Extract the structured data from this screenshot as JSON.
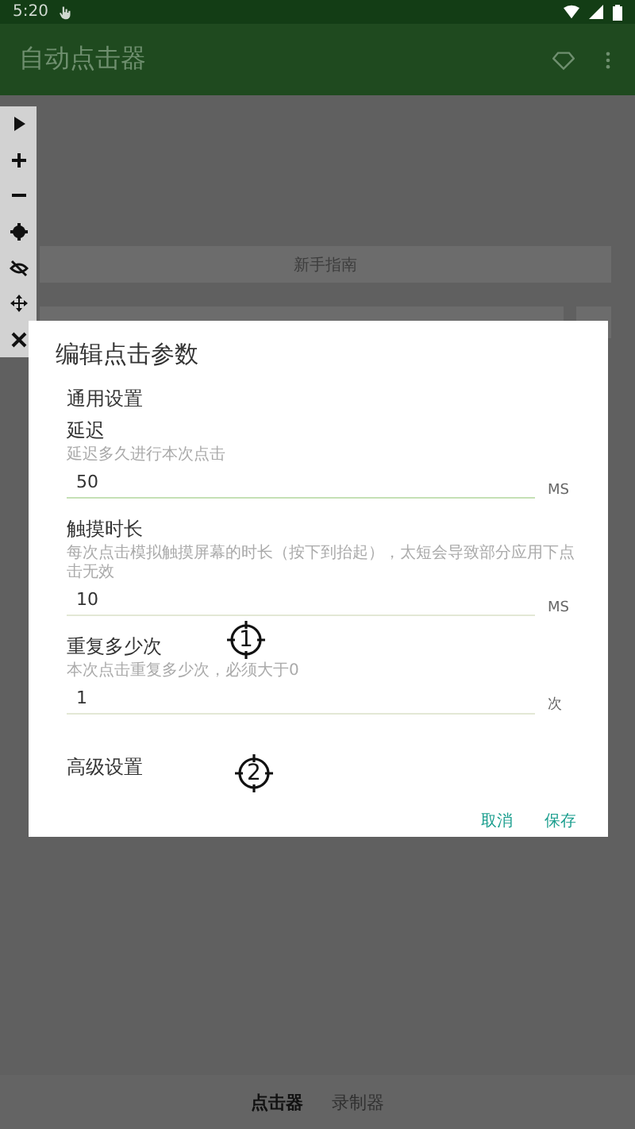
{
  "status_bar": {
    "time": "5:20"
  },
  "app_bar": {
    "title": "自动点击器"
  },
  "guide_button": {
    "label": "新手指南"
  },
  "dialog": {
    "title": "编辑点击参数",
    "section": "通用设置",
    "fields": [
      {
        "label": "延迟",
        "hint": "延迟多久进行本次点击",
        "value": "50",
        "unit": "MS",
        "focused": true
      },
      {
        "label": "触摸时长",
        "hint": "每次点击模拟触摸屏幕的时长（按下到抬起），太短会导致部分应用下点击无效",
        "value": "10",
        "unit": "MS",
        "focused": false
      },
      {
        "label": "重复多少次",
        "hint": "本次点击重复多少次，必须大于0",
        "value": "1",
        "unit": "次",
        "focused": false
      }
    ],
    "advanced": "高级设置",
    "buttons": [
      "取消",
      "保存"
    ]
  },
  "markers": [
    {
      "label": "1"
    },
    {
      "label": "2"
    }
  ],
  "bottom_nav": [
    {
      "label": "点击器",
      "selected": true
    },
    {
      "label": "录制器",
      "selected": false
    }
  ]
}
